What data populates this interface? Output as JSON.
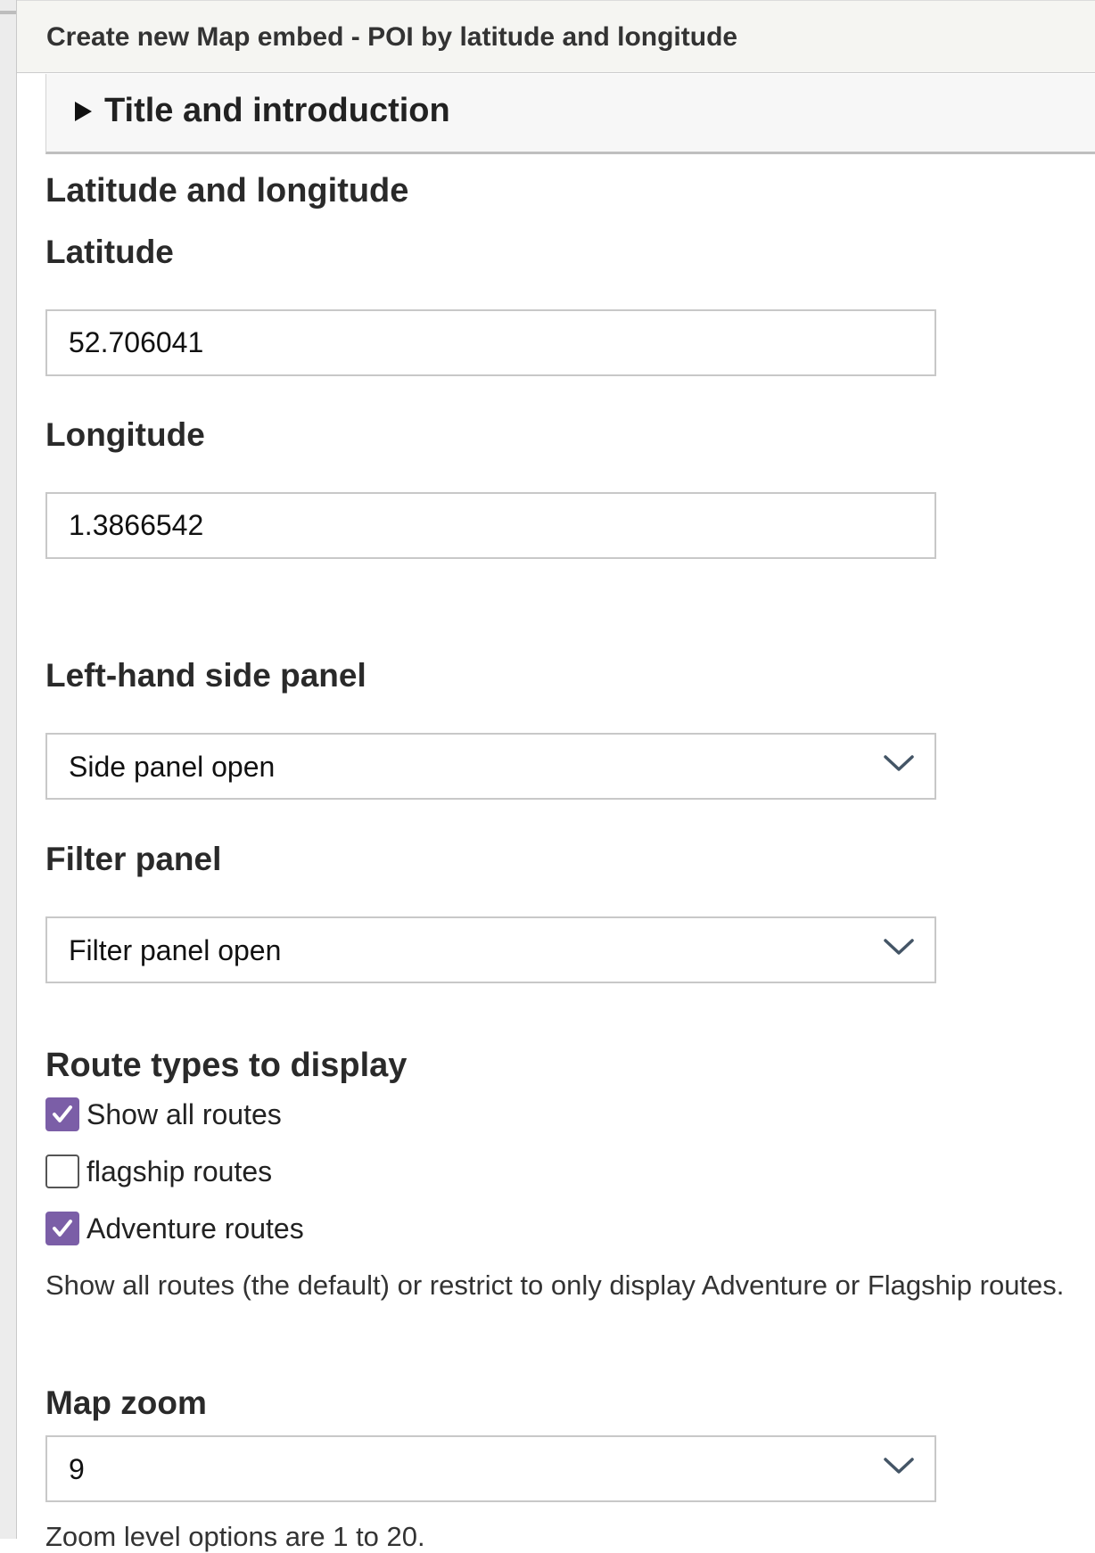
{
  "header": {
    "title": "Create new Map embed - POI by latitude and longitude"
  },
  "details": {
    "summary_label": "Title and introduction",
    "expanded": false
  },
  "latlng": {
    "section_heading": "Latitude and longitude",
    "latitude": {
      "label": "Latitude",
      "value": "52.706041"
    },
    "longitude": {
      "label": "Longitude",
      "value": "1.3866542"
    }
  },
  "side_panel": {
    "label": "Left-hand side panel",
    "selected": "Side panel open"
  },
  "filter_panel": {
    "label": "Filter panel",
    "selected": "Filter panel open"
  },
  "route_types": {
    "heading": "Route types to display",
    "options": [
      {
        "label": "Show all routes",
        "checked": true
      },
      {
        "label": "flagship routes",
        "checked": false
      },
      {
        "label": "Adventure routes",
        "checked": true
      }
    ],
    "help": "Show all routes (the default) or restrict to only display Adventure or Flagship routes."
  },
  "map_zoom": {
    "label": "Map zoom",
    "selected": "9",
    "help": "Zoom level options are 1 to 20."
  },
  "colors": {
    "checkbox_accent": "#7b5ea7",
    "header_bg": "#f5f5f2"
  },
  "icons": {
    "expand": "triangle-right-icon",
    "dropdown": "chevron-down-icon",
    "check": "checkmark-icon"
  }
}
